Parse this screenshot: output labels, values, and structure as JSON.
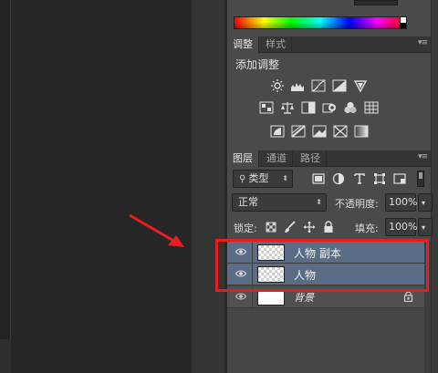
{
  "panels": {
    "adjustments": {
      "tabs": [
        {
          "label": "调整",
          "active": true
        },
        {
          "label": "样式",
          "active": false
        }
      ],
      "title": "添加调整",
      "icons": [
        [
          "brightness-contrast-icon",
          "levels-icon",
          "curves-icon",
          "exposure-icon",
          "vibrance-icon"
        ],
        [
          "hue-saturation-icon",
          "color-balance-icon",
          "black-white-icon",
          "photo-filter-icon",
          "channel-mixer-icon",
          "color-lookup-icon"
        ],
        [
          "invert-icon",
          "posterize-icon",
          "threshold-icon",
          "selective-color-icon",
          "gradient-map-icon"
        ]
      ]
    },
    "layers": {
      "tabs": [
        {
          "label": "图层",
          "active": true
        },
        {
          "label": "通道",
          "active": false
        },
        {
          "label": "路径",
          "active": false
        }
      ],
      "filter_kind": "类型",
      "blend_mode": "正常",
      "opacity_label": "不透明度:",
      "opacity_value": "100%",
      "lock_label": "锁定:",
      "fill_label": "填充:",
      "fill_value": "100%",
      "rows": [
        {
          "name": "人物 副本",
          "selected": true,
          "thumb": "transparent"
        },
        {
          "name": "人物",
          "selected": true,
          "thumb": "transparent"
        },
        {
          "name": "背景",
          "selected": false,
          "thumb": "white",
          "locked": true
        }
      ]
    }
  },
  "colors": {
    "selection": "#5b6d86",
    "annotation_red": "#e81e1e",
    "panel_bg": "#4a4a4a"
  }
}
